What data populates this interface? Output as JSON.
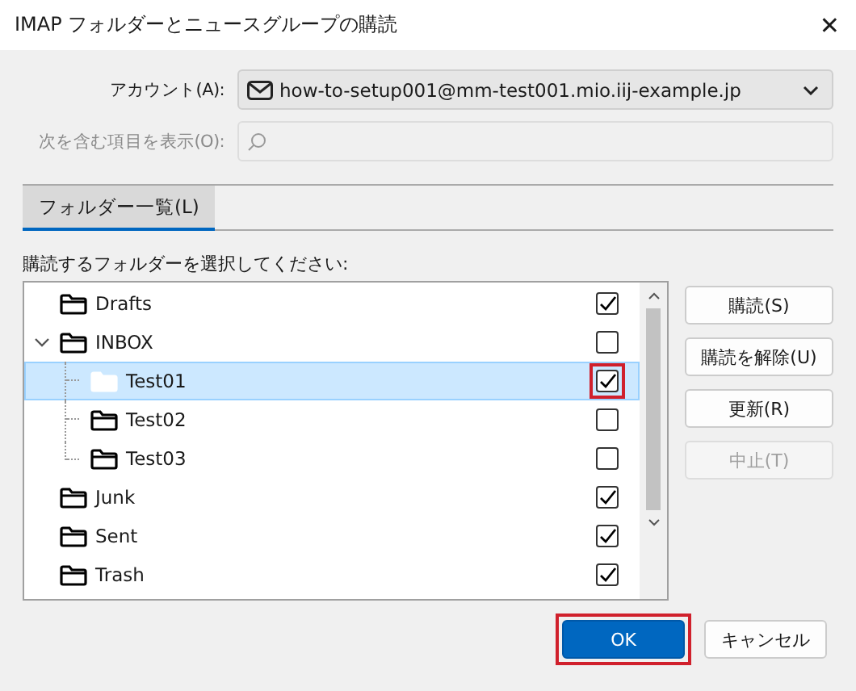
{
  "window": {
    "title": "IMAP フォルダーとニュースグループの購読",
    "close": "✕"
  },
  "account": {
    "label": "アカウント(A):",
    "value": "how-to-setup001@mm-test001.mio.iij-example.jp"
  },
  "filter": {
    "label": "次を含む項目を表示(O):",
    "disabled": true
  },
  "tabs": [
    {
      "label": "フォルダー一覧(L)",
      "selected": true
    }
  ],
  "list_label": "購読するフォルダーを選択してください:",
  "folders": [
    {
      "name": "Drafts",
      "checked": true,
      "selected": false,
      "highlighted": false
    },
    {
      "name": "INBOX",
      "checked": false,
      "selected": false,
      "highlighted": false,
      "expanded": true,
      "children": [
        {
          "name": "Test01",
          "checked": true,
          "selected": true,
          "highlighted": true
        },
        {
          "name": "Test02",
          "checked": false,
          "selected": false,
          "highlighted": false
        },
        {
          "name": "Test03",
          "checked": false,
          "selected": false,
          "highlighted": false
        }
      ]
    },
    {
      "name": "Junk",
      "checked": true,
      "selected": false,
      "highlighted": false
    },
    {
      "name": "Sent",
      "checked": true,
      "selected": false,
      "highlighted": false
    },
    {
      "name": "Trash",
      "checked": true,
      "selected": false,
      "highlighted": false
    }
  ],
  "side_buttons": [
    {
      "label": "購読(S)",
      "disabled": false
    },
    {
      "label": "購読を解除(U)",
      "disabled": false
    },
    {
      "label": "更新(R)",
      "disabled": false
    },
    {
      "label": "中止(T)",
      "disabled": true
    }
  ],
  "footer_buttons": [
    {
      "label": "OK",
      "kind": "primary",
      "highlighted": true
    },
    {
      "label": "キャンセル",
      "kind": "normal",
      "highlighted": false
    }
  ]
}
